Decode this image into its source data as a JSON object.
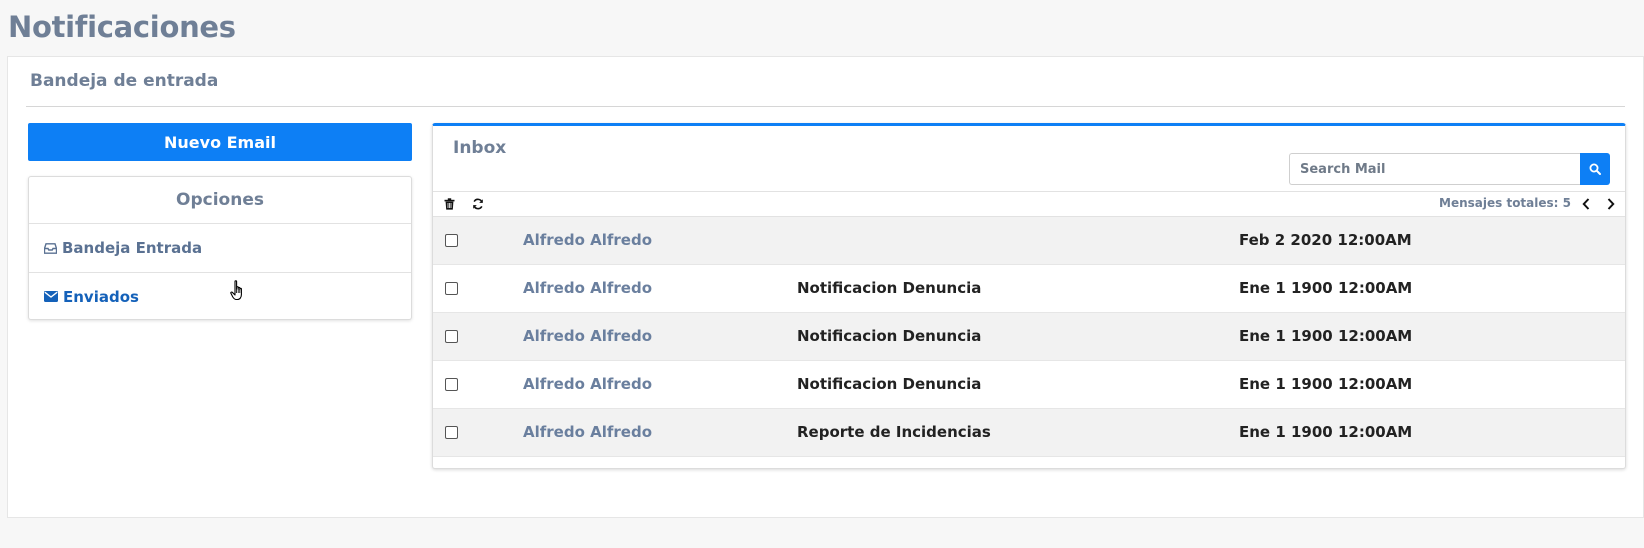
{
  "page": {
    "title": "Notificaciones"
  },
  "section": {
    "title": "Bandeja de entrada"
  },
  "compose": {
    "label": "Nuevo Email"
  },
  "options": {
    "title": "Opciones",
    "items": [
      {
        "label": "Bandeja Entrada",
        "icon": "inbox-icon"
      },
      {
        "label": "Enviados",
        "icon": "envelope-icon"
      }
    ]
  },
  "inbox": {
    "title": "Inbox",
    "search_placeholder": "Search Mail",
    "total_label": "Mensajes totales: 5",
    "messages": [
      {
        "sender": "Alfredo Alfredo",
        "subject": "",
        "date": "Feb 2 2020 12:00AM"
      },
      {
        "sender": "Alfredo Alfredo",
        "subject": "Notificacion Denuncia",
        "date": "Ene 1 1900 12:00AM"
      },
      {
        "sender": "Alfredo Alfredo",
        "subject": "Notificacion Denuncia",
        "date": "Ene 1 1900 12:00AM"
      },
      {
        "sender": "Alfredo Alfredo",
        "subject": "Notificacion Denuncia",
        "date": "Ene 1 1900 12:00AM"
      },
      {
        "sender": "Alfredo Alfredo",
        "subject": "Reporte de Incidencias",
        "date": "Ene 1 1900 12:00AM"
      }
    ]
  },
  "colors": {
    "primary": "#0d7ff5",
    "heading": "#6f7f96",
    "sender": "#6a7f9e",
    "sent_link": "#1461b9"
  }
}
